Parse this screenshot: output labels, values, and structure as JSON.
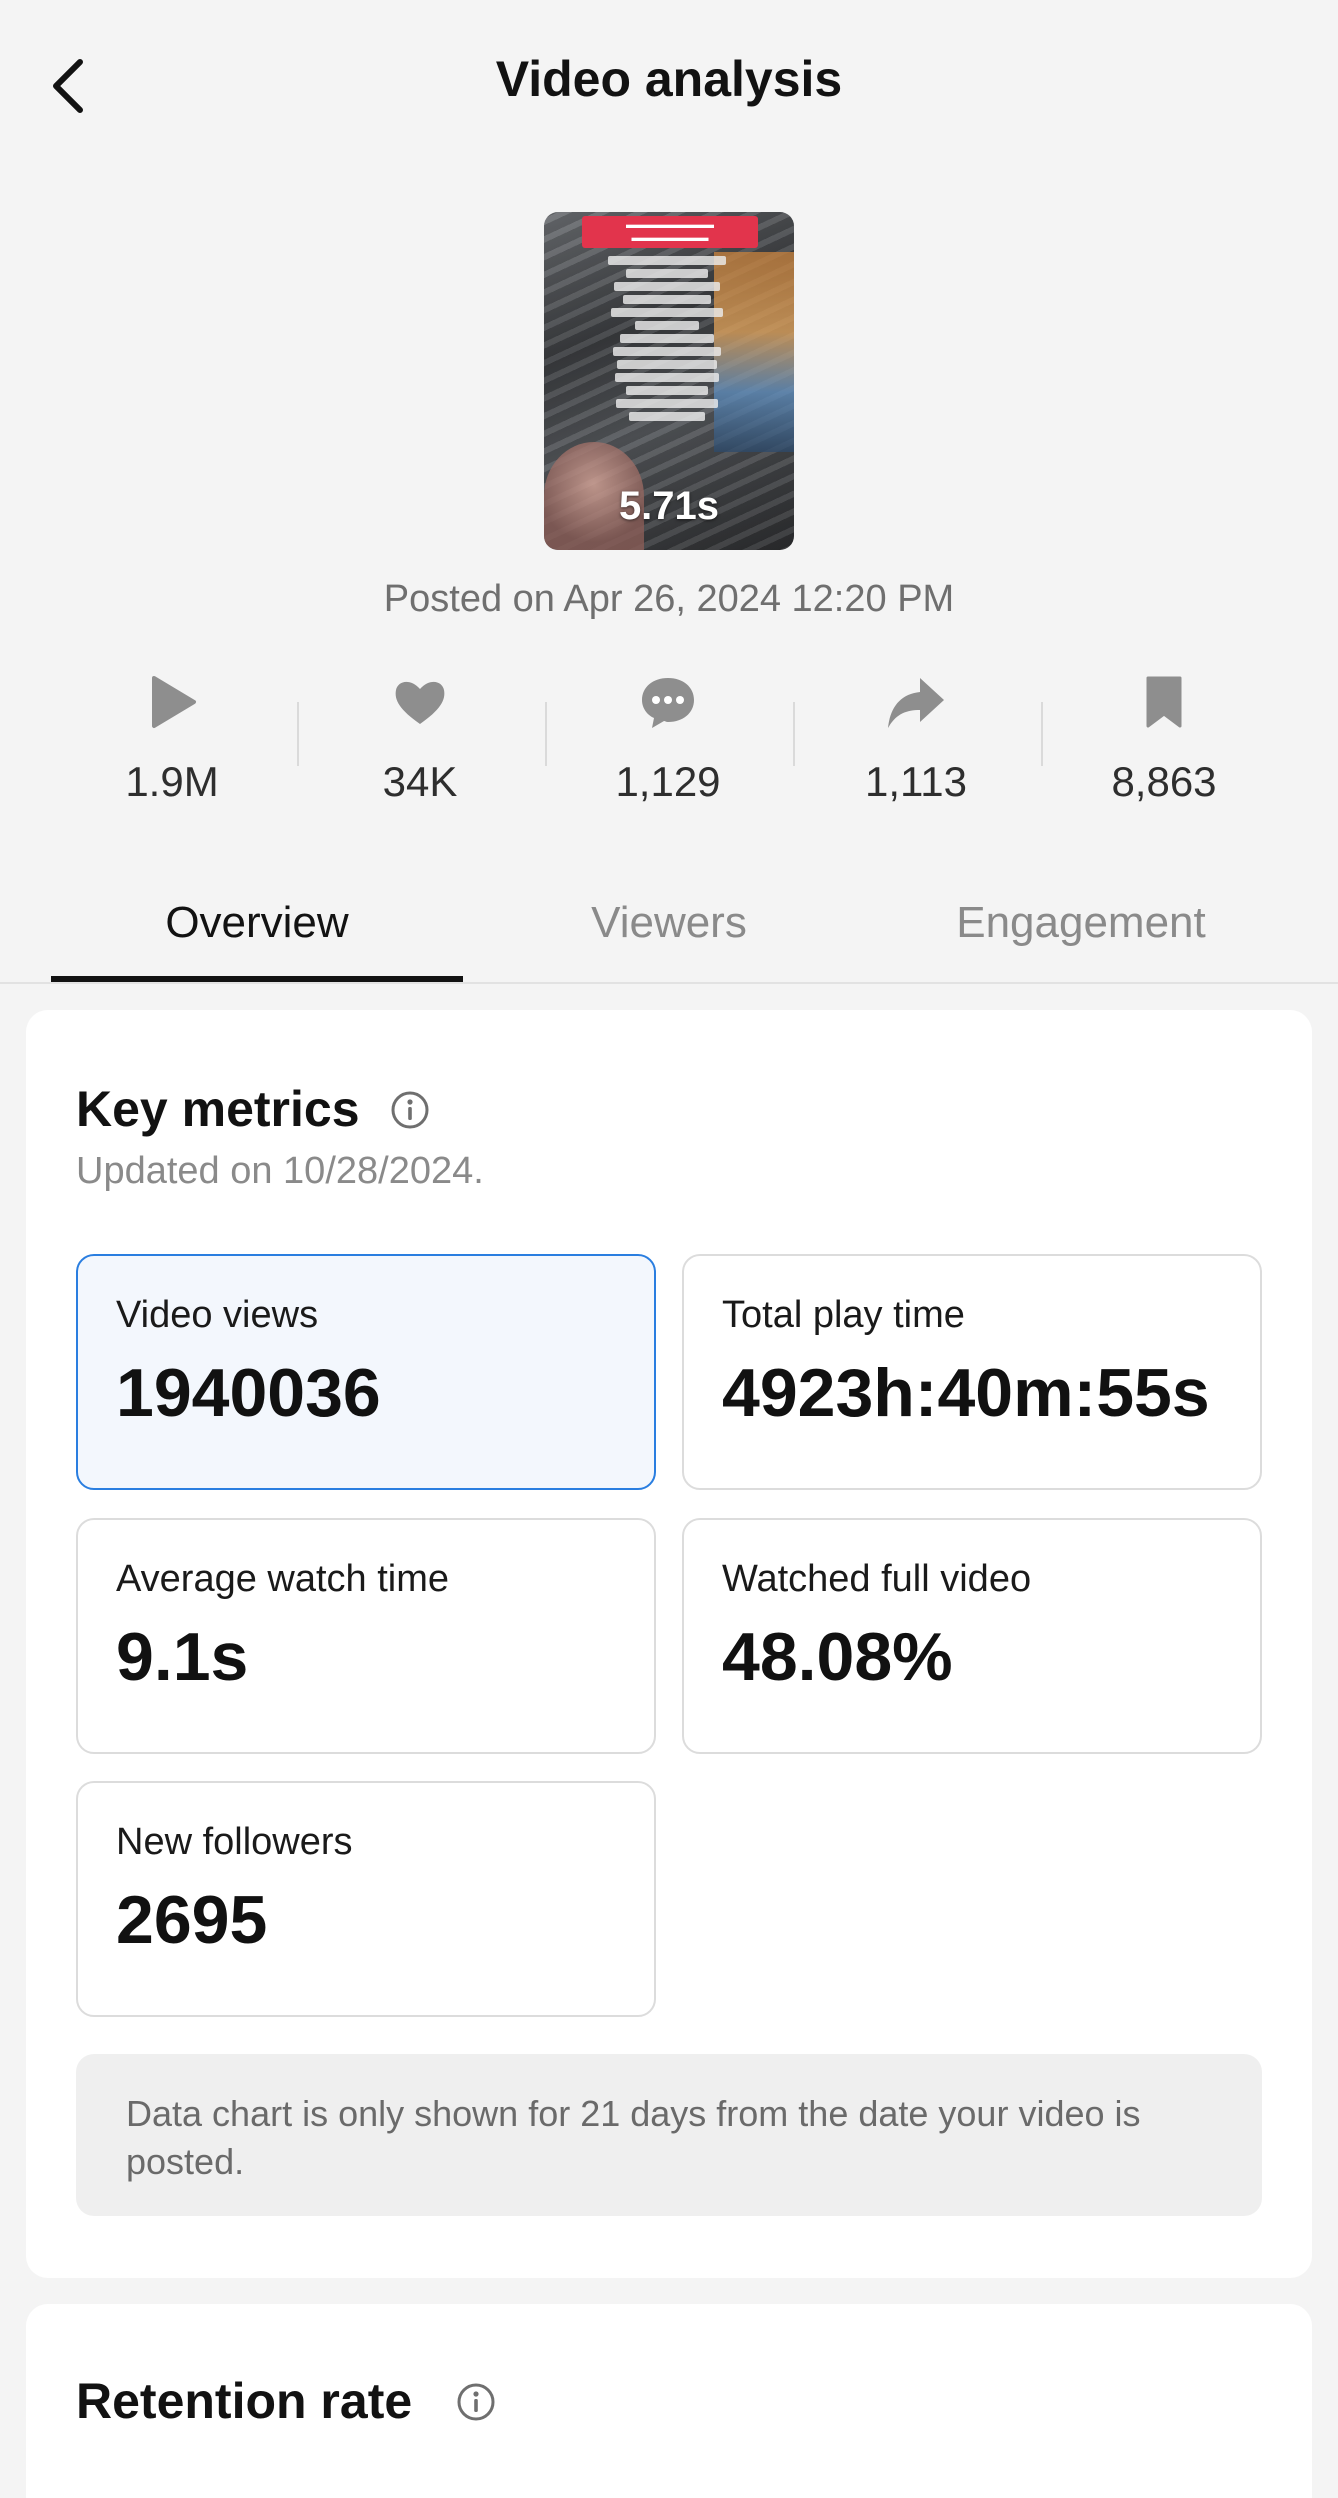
{
  "header": {
    "title": "Video analysis"
  },
  "video": {
    "duration": "5.71s",
    "posted": "Posted on Apr 26, 2024 12:20 PM"
  },
  "stats": [
    {
      "icon": "play-icon",
      "value": "1.9M"
    },
    {
      "icon": "heart-icon",
      "value": "34K"
    },
    {
      "icon": "comment-icon",
      "value": "1,129"
    },
    {
      "icon": "share-icon",
      "value": "1,113"
    },
    {
      "icon": "bookmark-icon",
      "value": "8,863"
    }
  ],
  "tabs": [
    {
      "label": "Overview",
      "active": true
    },
    {
      "label": "Viewers",
      "active": false
    },
    {
      "label": "Engagement",
      "active": false
    }
  ],
  "key_metrics": {
    "title": "Key metrics",
    "updated": "Updated on 10/28/2024.",
    "metrics": [
      {
        "label": "Video views",
        "value": "1940036",
        "selected": true
      },
      {
        "label": "Total play time",
        "value": "4923h:40m:55s",
        "selected": false
      },
      {
        "label": "Average watch time",
        "value": "9.1s",
        "selected": false
      },
      {
        "label": "Watched full video",
        "value": "48.08%",
        "selected": false
      },
      {
        "label": "New followers",
        "value": "2695",
        "selected": false
      }
    ],
    "note": "Data chart is only shown for 21 days from the date your video is posted."
  },
  "retention": {
    "title": "Retention rate"
  },
  "colors": {
    "accent": "#2a7ee0",
    "selected_bg": "#f3f7fd",
    "text": "#121212",
    "muted": "#8a8a8a"
  }
}
